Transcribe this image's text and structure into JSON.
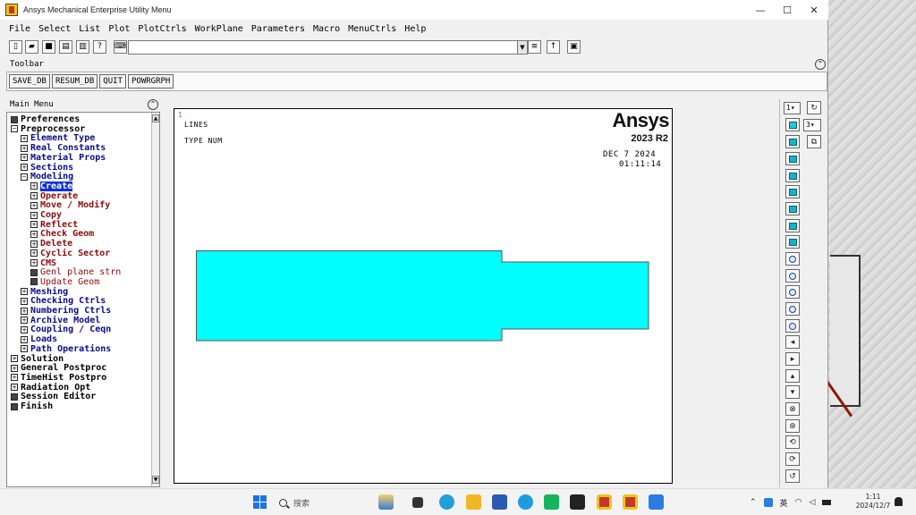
{
  "window": {
    "title": "Ansys Mechanical Enterprise Utility Menu",
    "minimize": "—",
    "maximize": "☐",
    "close": "✕"
  },
  "menubar": [
    "File",
    "Select",
    "List",
    "Plot",
    "PlotCtrls",
    "WorkPlane",
    "Parameters",
    "Macro",
    "MenuCtrls",
    "Help"
  ],
  "toolbar": {
    "label": "Toolbar",
    "buttons": [
      "SAVE_DB",
      "RESUM_DB",
      "QUIT",
      "POWRGRPH"
    ]
  },
  "main_menu": {
    "title": "Main Menu",
    "items": [
      {
        "label": "Preferences",
        "glyph": "leaf"
      },
      {
        "label": "Preprocessor",
        "glyph": "minus"
      },
      {
        "label": "Element Type",
        "glyph": "plus"
      },
      {
        "label": "Real Constants",
        "glyph": "plus"
      },
      {
        "label": "Material Props",
        "glyph": "plus"
      },
      {
        "label": "Sections",
        "glyph": "plus"
      },
      {
        "label": "Modeling",
        "glyph": "minus"
      },
      {
        "label": "Create",
        "glyph": "plus"
      },
      {
        "label": "Operate",
        "glyph": "plus"
      },
      {
        "label": "Move / Modify",
        "glyph": "plus"
      },
      {
        "label": "Copy",
        "glyph": "plus"
      },
      {
        "label": "Reflect",
        "glyph": "plus"
      },
      {
        "label": "Check Geom",
        "glyph": "plus"
      },
      {
        "label": "Delete",
        "glyph": "plus"
      },
      {
        "label": "Cyclic Sector",
        "glyph": "plus"
      },
      {
        "label": "CMS",
        "glyph": "plus"
      },
      {
        "label": "Genl plane strn",
        "glyph": "leaf"
      },
      {
        "label": "Update Geom",
        "glyph": "leaf"
      },
      {
        "label": "Meshing",
        "glyph": "plus"
      },
      {
        "label": "Checking Ctrls",
        "glyph": "plus"
      },
      {
        "label": "Numbering Ctrls",
        "glyph": "plus"
      },
      {
        "label": "Archive Model",
        "glyph": "plus"
      },
      {
        "label": "Coupling / Ceqn",
        "glyph": "plus"
      },
      {
        "label": "Loads",
        "glyph": "plus"
      },
      {
        "label": "Path Operations",
        "glyph": "plus"
      },
      {
        "label": "Solution",
        "glyph": "plus"
      },
      {
        "label": "General Postproc",
        "glyph": "plus"
      },
      {
        "label": "TimeHist Postpro",
        "glyph": "plus"
      },
      {
        "label": "Radiation Opt",
        "glyph": "plus"
      },
      {
        "label": "Session Editor",
        "glyph": "leaf"
      },
      {
        "label": "Finish",
        "glyph": "leaf"
      }
    ],
    "selected": "Create"
  },
  "graphics": {
    "window_number": "1",
    "line1": "LINES",
    "line2": "TYPE NUM",
    "brand": "Ansys",
    "version": "2023 R2",
    "date": "DEC  7 2024",
    "time": "01:11:14",
    "fill_color": "#00ffff"
  },
  "right_toolbar": {
    "window_select": "1",
    "view_select": "3"
  },
  "taskbar": {
    "search_placeholder": "搜索",
    "ime": "英",
    "time": "1:11",
    "date": "2024/12/7"
  }
}
